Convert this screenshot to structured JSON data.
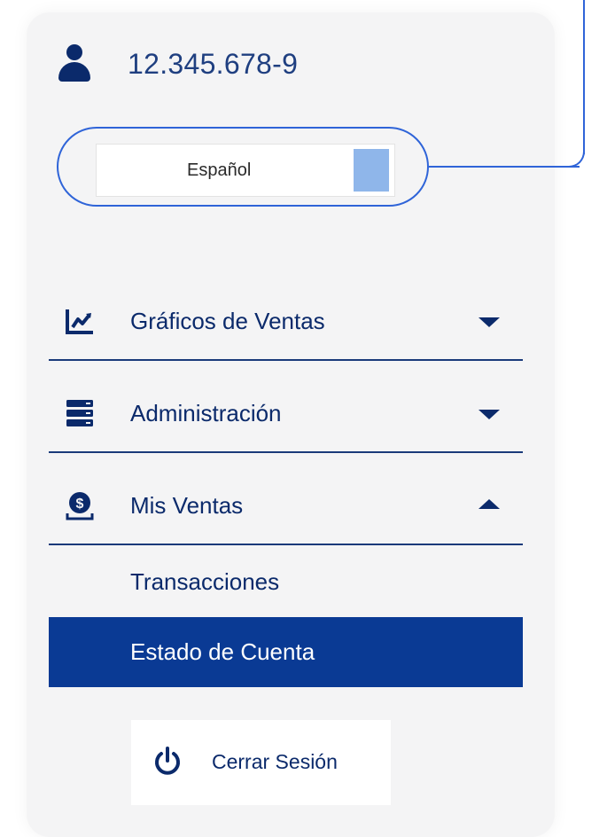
{
  "user": {
    "id": "12.345.678-9",
    "icon": "user-icon"
  },
  "language": {
    "selected": "Español",
    "swatch_color": "#8fb6ea",
    "highlight_color": "#2f64d8"
  },
  "menu": {
    "items": [
      {
        "label": "Gráficos de Ventas",
        "icon": "chart-line-icon",
        "expanded": false
      },
      {
        "label": "Administración",
        "icon": "server-icon",
        "expanded": false
      },
      {
        "label": "Mis Ventas",
        "icon": "money-bag-icon",
        "expanded": true,
        "children": [
          {
            "label": "Transacciones",
            "active": false
          },
          {
            "label": "Estado de Cuenta",
            "active": true
          }
        ]
      }
    ]
  },
  "logout": {
    "label": "Cerrar Sesión",
    "icon": "power-icon"
  },
  "colors": {
    "primary": "#0b2a6b",
    "active_bg": "#0a3a94",
    "panel_bg": "#f4f4f5"
  }
}
